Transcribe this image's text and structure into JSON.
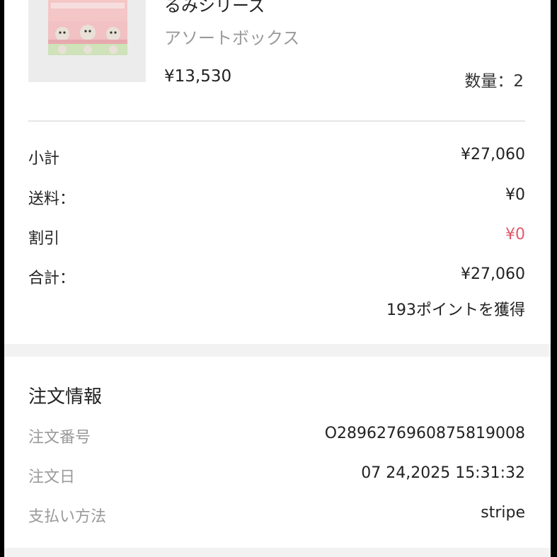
{
  "product": {
    "name_line": "るみシリーズ",
    "variant": "アソートボックス",
    "price": "¥13,530",
    "quantity": "数量：2"
  },
  "summary": {
    "rows": [
      {
        "label": "小計",
        "value": "¥27,060"
      },
      {
        "label": "送料：",
        "value": "¥0"
      },
      {
        "label": "割引",
        "value": "¥0"
      },
      {
        "label": "合計：",
        "value": "¥27,060"
      }
    ],
    "points": "193ポイントを獲得"
  },
  "order_info": {
    "title": "注文情報",
    "rows": [
      {
        "label": "注文番号",
        "value": "O2896276960875819008"
      },
      {
        "label": "注文日",
        "value": "07 24,2025 15:31:32"
      },
      {
        "label": "支払い方法",
        "value": "stripe"
      }
    ]
  },
  "colors": {
    "discount": "#e05a6a",
    "muted": "#9a9a9a",
    "background": "#f2f2f2"
  }
}
